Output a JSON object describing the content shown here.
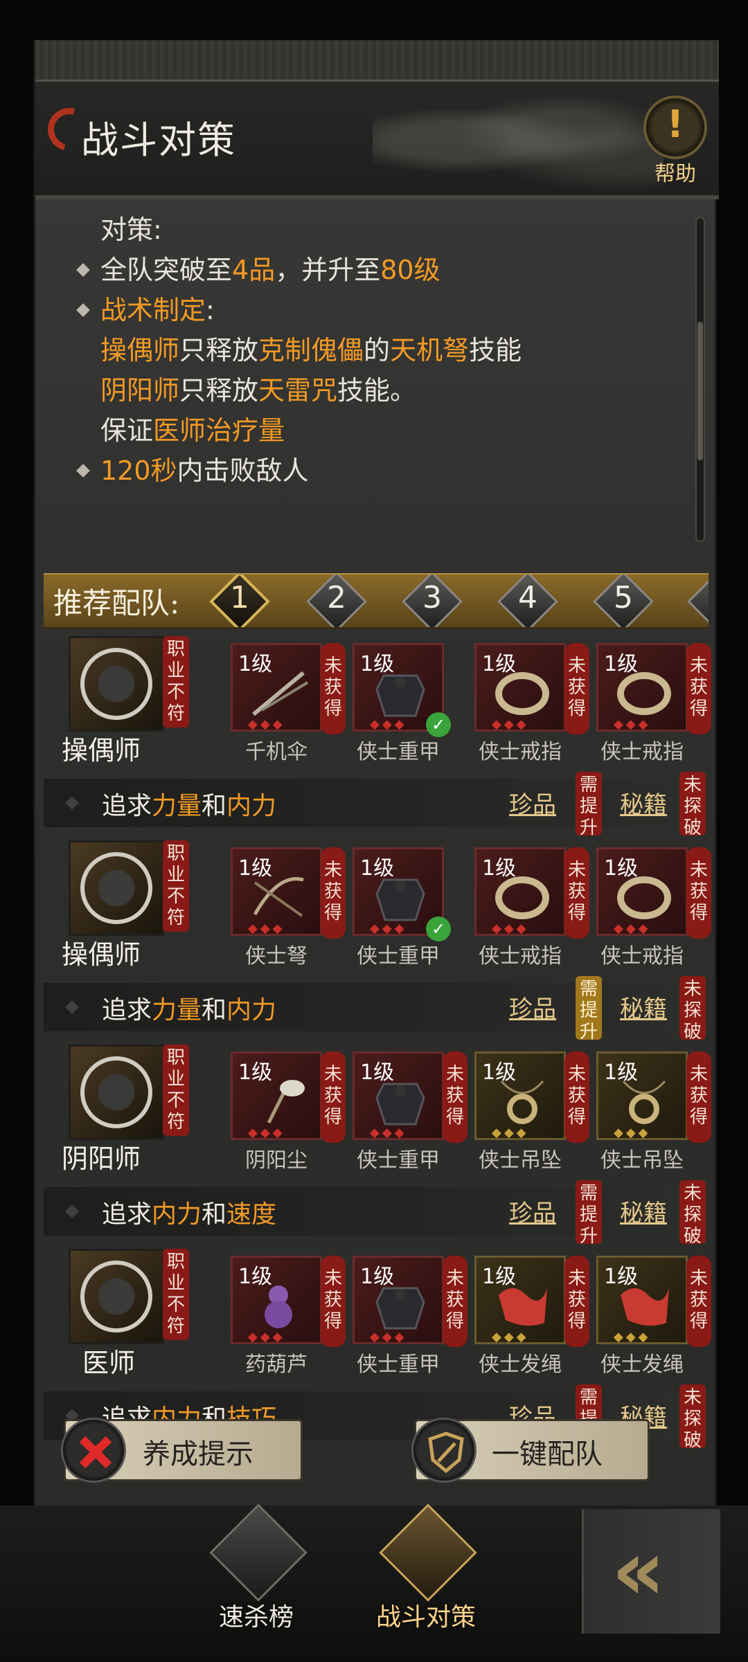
{
  "header": {
    "title": "战斗对策",
    "help_label": "帮助"
  },
  "strategy": {
    "heading": "对策:",
    "line1": {
      "pre": "全队突破至",
      "rank": "4品",
      "mid": "，并升至",
      "level": "80级"
    },
    "line2": {
      "tactic": "战术制定",
      "suffix": ":"
    },
    "line3": {
      "role": "操偶师",
      "a": "只释放",
      "target": "克制傀儡",
      "b": "的",
      "skill": "天机弩",
      "c": "技能"
    },
    "line4": {
      "role": "阴阳师",
      "a": "只释放",
      "skill": "天雷咒",
      "b": "技能。"
    },
    "line5": {
      "a": "保证",
      "focus": "医师治疗量"
    },
    "line6": {
      "time": "120秒",
      "a": "内击败敌人"
    }
  },
  "team_tabs": {
    "label": "推荐配队:",
    "tabs": [
      "1",
      "2",
      "3",
      "4",
      "5"
    ],
    "active": "1"
  },
  "tags": {
    "mismatch": "职业不符",
    "missing": "未获得",
    "need_upgrade": "需提升",
    "unexplored": "未探破"
  },
  "teams": [
    {
      "role": "操偶师",
      "equipment": [
        {
          "level": "1级",
          "name": "千机伞",
          "owned": false
        },
        {
          "level": "1级",
          "name": "侠士重甲",
          "owned": true
        },
        {
          "level": "1级",
          "name": "侠士戒指",
          "owned": false
        },
        {
          "level": "1级",
          "name": "侠士戒指",
          "owned": false
        }
      ],
      "pursuit": {
        "a": "追求",
        "stat1": "力量",
        "b": "和",
        "stat2": "内力"
      },
      "treasure": "珍品",
      "manual": "秘籍"
    },
    {
      "role": "操偶师",
      "equipment": [
        {
          "level": "1级",
          "name": "侠士弩",
          "owned": false
        },
        {
          "level": "1级",
          "name": "侠士重甲",
          "owned": true
        },
        {
          "level": "1级",
          "name": "侠士戒指",
          "owned": false
        },
        {
          "level": "1级",
          "name": "侠士戒指",
          "owned": false
        }
      ],
      "pursuit": {
        "a": "追求",
        "stat1": "力量",
        "b": "和",
        "stat2": "内力"
      },
      "treasure": "珍品",
      "manual": "秘籍"
    },
    {
      "role": "阴阳师",
      "equipment": [
        {
          "level": "1级",
          "name": "阴阳尘",
          "owned": false
        },
        {
          "level": "1级",
          "name": "侠士重甲",
          "owned": false
        },
        {
          "level": "1级",
          "name": "侠士吊坠",
          "owned": false
        },
        {
          "level": "1级",
          "name": "侠士吊坠",
          "owned": false
        }
      ],
      "pursuit": {
        "a": "追求",
        "stat1": "内力",
        "b": "和",
        "stat2": "速度"
      },
      "treasure": "珍品",
      "manual": "秘籍"
    },
    {
      "role": "医师",
      "equipment": [
        {
          "level": "1级",
          "name": "药葫芦",
          "owned": false
        },
        {
          "level": "1级",
          "name": "侠士重甲",
          "owned": false
        },
        {
          "level": "1级",
          "name": "侠士发绳",
          "owned": false
        },
        {
          "level": "1级",
          "name": "侠士发绳",
          "owned": false
        }
      ],
      "pursuit": {
        "a": "追求",
        "stat1": "内力",
        "b": "和",
        "stat2": "技巧"
      },
      "treasure": "珍品",
      "manual": "秘籍"
    }
  ],
  "actions": {
    "develop_tip": "养成提示",
    "auto_team": "一键配队"
  },
  "bottom_nav": {
    "speed_kill": "速杀榜",
    "battle_strategy": "战斗对策"
  },
  "colors": {
    "highlight": "#f29a24",
    "tag_red": "#8a1a15",
    "gold": "#d6b35a"
  }
}
